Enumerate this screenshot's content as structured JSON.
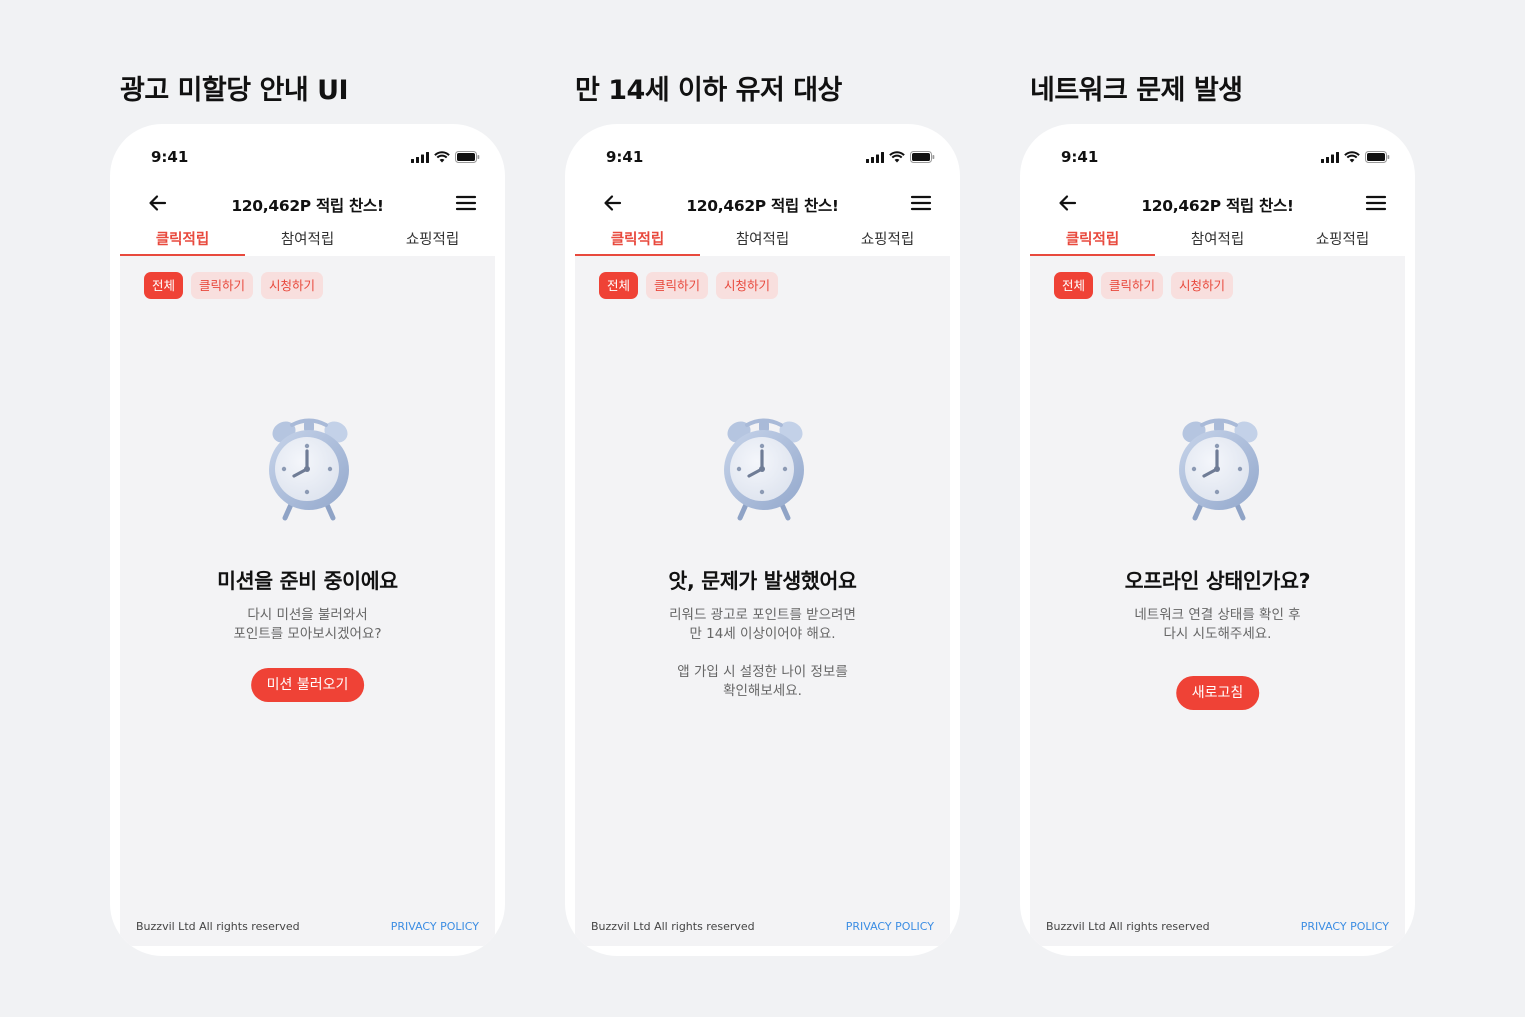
{
  "screens": [
    {
      "section_title": "광고 미할당 안내 UI",
      "status_time": "9:41",
      "nav_title": "120,462P 적립 찬스!",
      "tabs": [
        "클릭적립",
        "참여적립",
        "쇼핑적립"
      ],
      "chips": [
        "전체",
        "클릭하기",
        "시청하기"
      ],
      "message_title": "미션을 준비 중이에요",
      "message_lines": [
        "다시 미션을 불러와서",
        "포인트를 모아보시겠어요?"
      ],
      "button_label": "미션 불러오기",
      "footer_copyright": "Buzzvil Ltd All rights reserved",
      "footer_privacy": "PRIVACY POLICY"
    },
    {
      "section_title": "만 14세 이하  유저 대상",
      "status_time": "9:41",
      "nav_title": "120,462P 적립 찬스!",
      "tabs": [
        "클릭적립",
        "참여적립",
        "쇼핑적립"
      ],
      "chips": [
        "전체",
        "클릭하기",
        "시청하기"
      ],
      "message_title": "앗, 문제가 발생했어요",
      "message_lines": [
        "리워드 광고로 포인트를 받으려면",
        "만 14세 이상이어야 해요."
      ],
      "message_lines_2": [
        "앱 가입 시 설정한 나이 정보를",
        "확인해보세요."
      ],
      "footer_copyright": "Buzzvil Ltd All rights reserved",
      "footer_privacy": "PRIVACY POLICY"
    },
    {
      "section_title": "네트워크 문제 발생",
      "status_time": "9:41",
      "nav_title": "120,462P 적립 찬스!",
      "tabs": [
        "클릭적립",
        "참여적립",
        "쇼핑적립"
      ],
      "chips": [
        "전체",
        "클릭하기",
        "시청하기"
      ],
      "message_title": "오프라인 상태인가요?",
      "message_lines": [
        "네트워크 연결 상태를 확인 후",
        "다시 시도해주세요."
      ],
      "button_label": "새로고침",
      "footer_copyright": "Buzzvil Ltd All rights reserved",
      "footer_privacy": "PRIVACY POLICY"
    }
  ],
  "active_tab_index": 0,
  "active_chip_index": 0,
  "colors": {
    "accent": "#ef4236",
    "accent_text": "#e8493d",
    "chip_inactive_bg": "#f8dfde",
    "privacy_link": "#3b8de3",
    "page_bg": "#f1f2f4",
    "content_bg": "#f3f3f5"
  },
  "icons": [
    "arrow-left-icon",
    "hamburger-menu-icon",
    "cellular-signal-icon",
    "wifi-icon",
    "battery-icon",
    "alarm-clock-icon"
  ]
}
